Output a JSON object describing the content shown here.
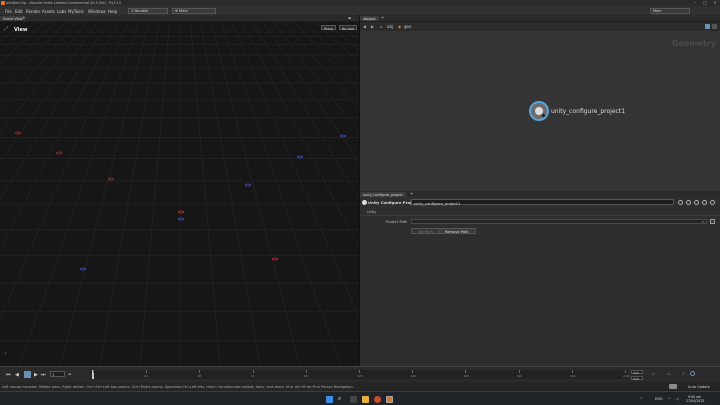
{
  "window": {
    "title": "untitled.hip - Houdini Indie Limited-Commercial 20.5.550 - Py3.11"
  },
  "menu": [
    "File",
    "Edit",
    "Render",
    "Assets",
    "Labs",
    "MyTools",
    "Windows",
    "Help"
  ],
  "desktop": {
    "value": "Houdini"
  },
  "desktop_prefix": "1",
  "desktop_main": "Main",
  "desktop_right": "Main",
  "scene_view_tab": "Scene View",
  "viewport": {
    "title": "View",
    "persp": "Persp",
    "cam": "No cam"
  },
  "network_tab": "obj/geo",
  "network_path": {
    "root": "obj",
    "node": "geo"
  },
  "network_context_label": "Geometry",
  "node": {
    "name": "unity_configure_project1"
  },
  "param_tab": "unity_configure_project",
  "param_header": {
    "type": "Unity Configure Project",
    "name": "unity_configure_project1"
  },
  "params": {
    "section": "Unity",
    "project_path_label": "Project Path",
    "project_path_value": "",
    "setup_button": "Set Path",
    "remove_button": "Remove Path"
  },
  "timeline": {
    "frame": "1",
    "ticks": [
      "1",
      "24",
      "48",
      "72",
      "96",
      "120",
      "144",
      "168",
      "192",
      "216",
      "240"
    ],
    "end1": "240",
    "end2": "240"
  },
  "status": {
    "text": "Left mouse tumbles. Middle pans. Right dollies. Ctrl+Alt+Left box-zooms. Ctrl+Right zooms. Spacebar-Ctrl-Left tilts. Hold L for alternate tumble, dolly, and zoom.  M or Alt+M for First Person Navigation.",
    "auto_update": "Auto Update"
  },
  "taskbar": {
    "lang": "ENG",
    "time": "9:00 am",
    "date": "27/04/2025"
  }
}
